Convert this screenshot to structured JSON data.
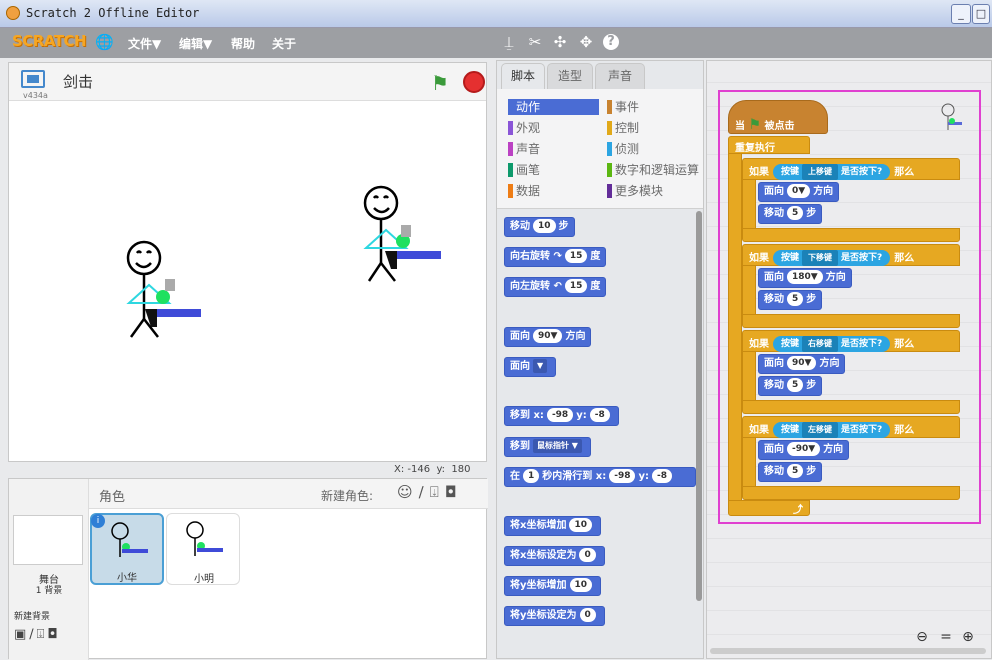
{
  "window": {
    "title": "Scratch 2 Offline Editor"
  },
  "menubar": {
    "logo": "SCRATCH",
    "items": [
      "文件▼",
      "编辑▼",
      "帮助",
      "关于"
    ]
  },
  "stage": {
    "title": "剑击",
    "version": "v434a",
    "x_label": "X:",
    "x_val": "-146",
    "y_label": "y:",
    "y_val": "180"
  },
  "sprites": {
    "header": "角色",
    "new_sprite": "新建角色:",
    "stage_label": "舞台",
    "stage_sub": "1 背景",
    "new_backdrop": "新建背景",
    "items": [
      {
        "name": "小华",
        "selected": true
      },
      {
        "name": "小明",
        "selected": false
      }
    ]
  },
  "tabs": [
    "脚本",
    "造型",
    "声音"
  ],
  "categories": {
    "left": [
      {
        "label": "动作",
        "color": "#4a6cd4"
      },
      {
        "label": "外观",
        "color": "#8a55d7"
      },
      {
        "label": "声音",
        "color": "#bb42c3"
      },
      {
        "label": "画笔",
        "color": "#0e9a6c"
      },
      {
        "label": "数据",
        "color": "#ee7d16"
      }
    ],
    "right": [
      {
        "label": "事件",
        "color": "#c88330"
      },
      {
        "label": "控制",
        "color": "#e1a91a"
      },
      {
        "label": "侦测",
        "color": "#2ca5e2"
      },
      {
        "label": "数字和逻辑运算",
        "color": "#5cb712"
      },
      {
        "label": "更多模块",
        "color": "#632d99"
      }
    ]
  },
  "palette": {
    "move": [
      "移动",
      "10",
      "步"
    ],
    "turn_right": [
      "向右旋转",
      "15",
      "度"
    ],
    "turn_left": [
      "向左旋转",
      "15",
      "度"
    ],
    "point_dir": [
      "面向",
      "90▼",
      "方向"
    ],
    "point_towards": [
      "面向",
      "▼"
    ],
    "goto_xy": [
      "移到 x:",
      "-98",
      "y:",
      "-8"
    ],
    "goto": [
      "移到",
      "鼠标指针 ▼"
    ],
    "glide": [
      "在",
      "1",
      "秒内滑行到 x:",
      "-98",
      "y:",
      "-8"
    ],
    "change_x": [
      "将x坐标增加",
      "10"
    ],
    "set_x": [
      "将x坐标设定为",
      "0"
    ],
    "change_y": [
      "将y坐标增加",
      "10"
    ],
    "set_y": [
      "将y坐标设定为",
      "0"
    ]
  },
  "script": {
    "hat": [
      "当",
      "被点击"
    ],
    "forever": "重复执行",
    "if_label": "如果",
    "key_label": "按键",
    "pressed": "是否按下?",
    "then": "那么",
    "face": "面向",
    "dir_label": "方向",
    "move": "移动",
    "step": "步",
    "ifs": [
      {
        "key": "上移键",
        "dir": "0▼",
        "steps": "5"
      },
      {
        "key": "下移键",
        "dir": "180▼",
        "steps": "5"
      },
      {
        "key": "右移键",
        "dir": "90▼",
        "steps": "5"
      },
      {
        "key": "左移键",
        "dir": "-90▼",
        "steps": "5"
      }
    ]
  },
  "icons": [
    "globe-icon",
    "stamp-icon",
    "cut-icon",
    "grow-icon",
    "shrink-icon",
    "help-icon",
    "green-flag-icon",
    "stop-icon",
    "zoom-out-icon",
    "zoom-reset-icon",
    "zoom-in-icon"
  ]
}
